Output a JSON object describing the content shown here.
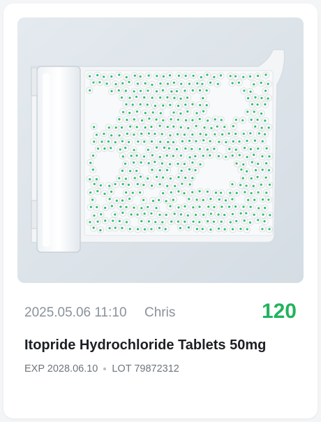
{
  "card": {
    "datetime": "2025.05.06 11:10",
    "user": "Chris",
    "count": "120",
    "drug_name": "Itopride Hydrochloride Tablets 50mg",
    "exp_label": "EXP 2028.06.10",
    "lot_label": "LOT 79872312",
    "photo_subject": "pill-counting-tray-image",
    "colors": {
      "count": "#22b35e",
      "pill_mark": "#2fbf6a",
      "secondary_text": "#8a9199"
    }
  }
}
